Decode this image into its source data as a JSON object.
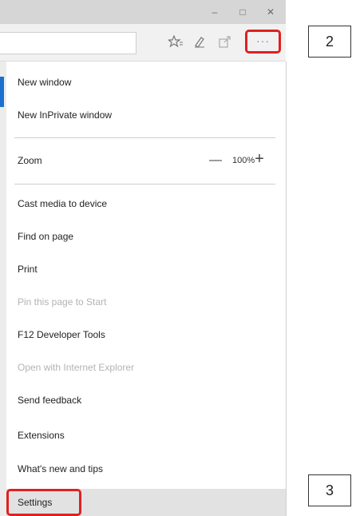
{
  "window": {
    "minimize_icon": "minimize-icon",
    "maximize_icon": "maximize-icon",
    "close_icon": "close-icon",
    "minimize_glyph": "–",
    "maximize_glyph": "□",
    "close_glyph": "✕"
  },
  "toolbar": {
    "favorites_icon": "favorites-star-icon",
    "notes_icon": "web-note-pen-icon",
    "share_icon": "share-icon",
    "more_icon": "more-dots-icon",
    "more_glyph": "···",
    "highlight_color": "#e02020"
  },
  "menu": {
    "new_window": "New window",
    "new_inprivate": "New InPrivate window",
    "zoom_label": "Zoom",
    "zoom_minus": "—",
    "zoom_value": "100%",
    "zoom_plus": "+",
    "cast": "Cast media to device",
    "find": "Find on page",
    "print": "Print",
    "pin": "Pin this page to Start",
    "f12": "F12 Developer Tools",
    "open_ie": "Open with Internet Explorer",
    "feedback": "Send feedback",
    "extensions": "Extensions",
    "whats_new": "What's new and tips",
    "settings": "Settings"
  },
  "callouts": {
    "step2": "2",
    "step3": "3"
  }
}
